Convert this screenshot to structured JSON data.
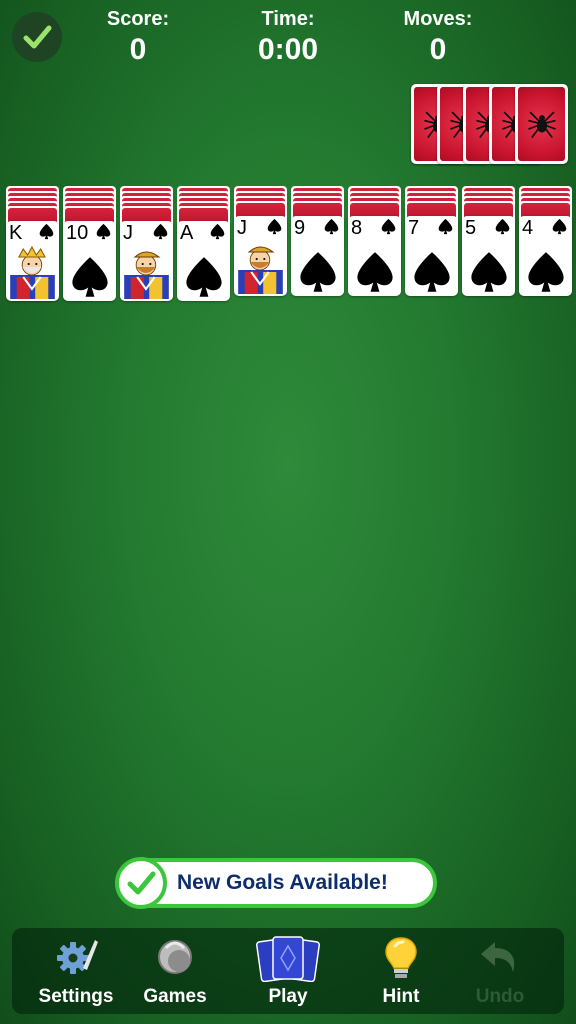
{
  "header": {
    "score_label": "Score:",
    "score_value": "0",
    "time_label": "Time:",
    "time_value": "0:00",
    "moves_label": "Moves:",
    "moves_value": "0"
  },
  "stock": {
    "remaining_deals": 5
  },
  "tableau": [
    {
      "facedown": 5,
      "rank": "K",
      "suit": "spade",
      "court": "king"
    },
    {
      "facedown": 5,
      "rank": "10",
      "suit": "spade"
    },
    {
      "facedown": 5,
      "rank": "J",
      "suit": "spade",
      "court": "jack"
    },
    {
      "facedown": 5,
      "rank": "A",
      "suit": "spade"
    },
    {
      "facedown": 4,
      "rank": "J",
      "suit": "spade",
      "court": "jack"
    },
    {
      "facedown": 4,
      "rank": "9",
      "suit": "spade"
    },
    {
      "facedown": 4,
      "rank": "8",
      "suit": "spade"
    },
    {
      "facedown": 4,
      "rank": "7",
      "suit": "spade"
    },
    {
      "facedown": 4,
      "rank": "5",
      "suit": "spade"
    },
    {
      "facedown": 4,
      "rank": "4",
      "suit": "spade"
    }
  ],
  "banner": {
    "text": "New Goals Available!"
  },
  "toolbar": {
    "settings": "Settings",
    "games": "Games",
    "play": "Play",
    "hint": "Hint",
    "undo": "Undo"
  },
  "colors": {
    "felt": "#237a30",
    "card_back": "#c8142e",
    "accent_green": "#3cc63c",
    "banner_text": "#0d2e6e"
  }
}
